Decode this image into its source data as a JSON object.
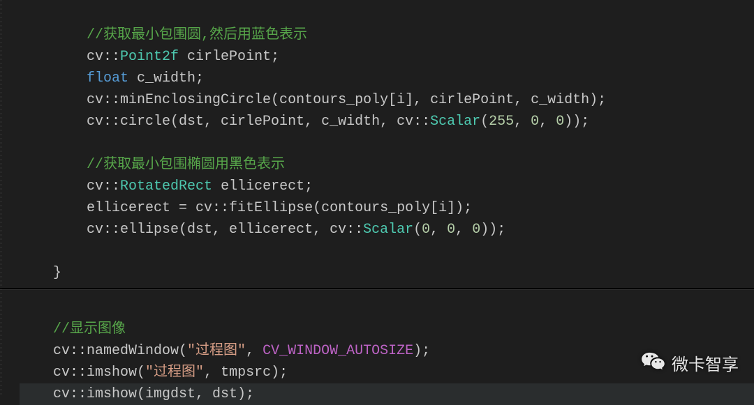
{
  "code": {
    "block1": {
      "comment1": "//获取最小包围圆,然后用蓝色表示",
      "l2_a": "cv::",
      "l2_type": "Point2f",
      "l2_b": " cirlePoint;",
      "l3_kw": "float",
      "l3_b": " c_width;",
      "l4_a": "cv::minEnclosingCircle(contours_poly[i], cirlePoint, c_width);",
      "l5_a": "cv::circle(dst, cirlePoint, c_width, cv::",
      "l5_type": "Scalar",
      "l5_b": "(",
      "l5_n1": "255",
      "l5_c": ", ",
      "l5_n2": "0",
      "l5_d": ", ",
      "l5_n3": "0",
      "l5_e": "));",
      "comment2": "//获取最小包围椭圆用黑色表示",
      "l7_a": "cv::",
      "l7_type": "RotatedRect",
      "l7_b": " ellicerect;",
      "l8_a": "ellicerect = cv::fitEllipse(contours_poly[i]);",
      "l9_a": "cv::ellipse(dst, ellicerect, cv::",
      "l9_type": "Scalar",
      "l9_b": "(",
      "l9_n1": "0",
      "l9_c": ", ",
      "l9_n2": "0",
      "l9_d": ", ",
      "l9_n3": "0",
      "l9_e": "));",
      "brace": "}"
    },
    "block2": {
      "comment3": "//显示图像",
      "l11_a": "cv::namedWindow(",
      "l11_str": "\"过程图\"",
      "l11_b": ", ",
      "l11_macro": "CV_WINDOW_AUTOSIZE",
      "l11_c": ");",
      "l12_a": "cv::imshow(",
      "l12_str": "\"过程图\"",
      "l12_b": ", tmpsrc);",
      "l13_a": "cv::imshow(imgdst, dst);"
    }
  },
  "watermark": {
    "text": "微卡智享"
  }
}
